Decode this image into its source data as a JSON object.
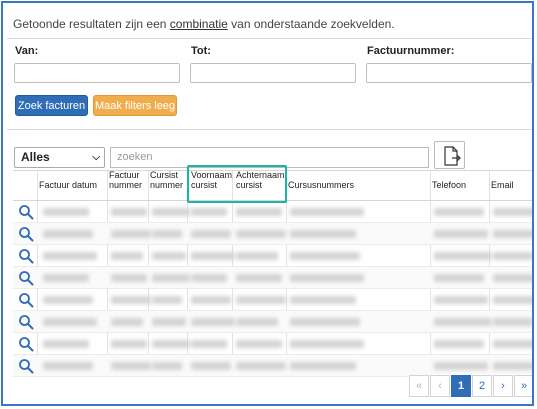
{
  "intro": {
    "prefix": "Getoonde resultaten zijn een",
    "emphasis": "combinatie",
    "suffix": "van onderstaande zoekvelden."
  },
  "filters": {
    "van_label": "Van:",
    "tot_label": "Tot:",
    "factuurnummer_label": "Factuurnummer:",
    "van_value": "",
    "tot_value": "",
    "factuurnummer_value": ""
  },
  "buttons": {
    "search": "Zoek facturen",
    "clear": "Maak filters leeg"
  },
  "toolbar": {
    "select_value": "Alles",
    "search_placeholder": "zoeken"
  },
  "columns": [
    {
      "line1": "",
      "line2": "Factuur datum"
    },
    {
      "line1": "Factuur",
      "line2": "nummer"
    },
    {
      "line1": "Cursist",
      "line2": "nummer"
    },
    {
      "line1": "Voornaam",
      "line2": "cursist"
    },
    {
      "line1": "Achternaam",
      "line2": "cursist"
    },
    {
      "line1": "",
      "line2": "Cursusnummers"
    },
    {
      "line1": "",
      "line2": "Telefoon"
    },
    {
      "line1": "",
      "line2": "Email"
    }
  ],
  "rows": [
    {
      "blurred": true
    },
    {
      "blurred": true
    },
    {
      "blurred": true
    },
    {
      "blurred": true
    },
    {
      "blurred": true
    },
    {
      "blurred": true
    },
    {
      "blurred": true
    },
    {
      "blurred": true
    }
  ],
  "pagination": {
    "first": "«",
    "prev": "‹",
    "page1": "1",
    "page2": "2",
    "next": "›",
    "last": "»"
  },
  "colors": {
    "frame": "#3b78c4",
    "primary": "#2f6db7",
    "warning": "#f0ad4e",
    "highlight": "#1fb3a6"
  }
}
